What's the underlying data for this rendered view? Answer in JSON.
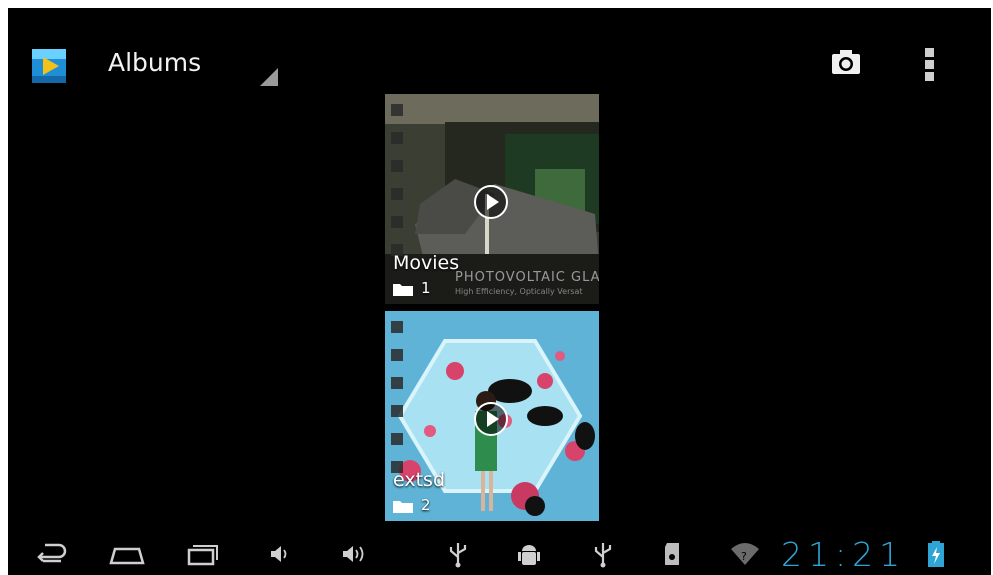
{
  "action_bar": {
    "title": "Albums",
    "app_icon": "gallery-icon",
    "camera_icon": "camera-icon",
    "overflow_icon": "overflow-menu-icon"
  },
  "albums": [
    {
      "label": "Movies",
      "count": "1",
      "watermark": "PHOTOVOLTAIC GLA",
      "watermark_sub": "High Efficiency, Optically Versat"
    },
    {
      "label": "extsd",
      "count": "2"
    }
  ],
  "system_bar": {
    "icons": [
      "back-icon",
      "home-icon",
      "recent-apps-icon",
      "volume-down-icon",
      "volume-up-icon",
      "usb-icon",
      "android-debug-icon",
      "usb-icon",
      "sd-card-icon",
      "wifi-icon",
      "battery-charging-icon"
    ],
    "clock": "21:21"
  },
  "colors": {
    "background": "#000000",
    "clock": "#2fa5d6",
    "accent": "#33b5e5"
  }
}
